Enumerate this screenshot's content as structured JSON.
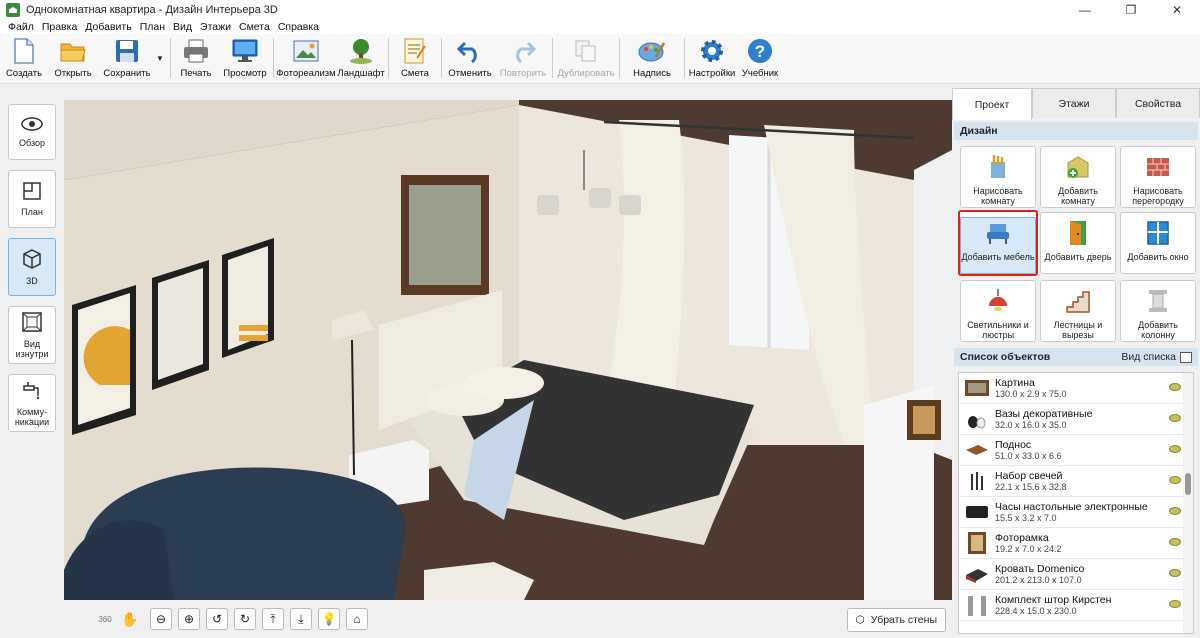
{
  "window": {
    "title": "Однокомнатная квартира - Дизайн Интерьера 3D"
  },
  "menu": [
    "Файл",
    "Правка",
    "Добавить",
    "План",
    "Вид",
    "Этажи",
    "Смета",
    "Справка"
  ],
  "toolbar": {
    "create": "Создать",
    "open": "Открыть",
    "save": "Сохранить",
    "print": "Печать",
    "preview": "Просмотр",
    "photorealism": "Фотореализм",
    "landscape": "Ландшафт",
    "estimate": "Смета",
    "undo": "Отменить",
    "redo": "Повторить",
    "duplicate": "Дублировать",
    "caption": "Надпись",
    "settings": "Настройки",
    "tutorial": "Учебник"
  },
  "left_panel": {
    "overview": "Обзор",
    "plan": "План",
    "view3d": "3D",
    "inside": "Вид изнутри",
    "utilities": "Комму-никации"
  },
  "right_panel": {
    "tabs": [
      "Проект",
      "Этажи",
      "Свойства"
    ],
    "active_tab": "Проект",
    "design_header": "Дизайн",
    "tools": [
      {
        "label": "Нарисовать комнату",
        "icon": "pencils-icon"
      },
      {
        "label": "Добавить комнату",
        "icon": "add-room-icon"
      },
      {
        "label": "Нарисовать перегородку",
        "icon": "brick-wall-icon"
      },
      {
        "label": "Добавить мебель",
        "icon": "armchair-icon"
      },
      {
        "label": "Добавить дверь",
        "icon": "door-icon"
      },
      {
        "label": "Добавить окно",
        "icon": "window-icon"
      },
      {
        "label": "Светильники и люстры",
        "icon": "ceiling-lamp-icon"
      },
      {
        "label": "Лестницы и вырезы",
        "icon": "stairs-icon"
      },
      {
        "label": "Добавить колонну",
        "icon": "column-icon"
      }
    ],
    "objects_header": "Список объектов",
    "list_view": "Вид списка",
    "objects": [
      {
        "name": "Картина",
        "dims": "130.0 x 2.9 x 75.0"
      },
      {
        "name": "Вазы декоративные",
        "dims": "32.0 x 16.0 x 35.0"
      },
      {
        "name": "Поднос",
        "dims": "51.0 x 33.0 x 6.6"
      },
      {
        "name": "Набор свечей",
        "dims": "22.1 x 15.6 x 32.8"
      },
      {
        "name": "Часы настольные электронные",
        "dims": "15.5 x 3.2 x 7.0"
      },
      {
        "name": "Фоторамка",
        "dims": "19.2 x 7.0 x 24.2"
      },
      {
        "name": "Кровать Domenico",
        "dims": "201.2 x 213.0 x 107.0"
      },
      {
        "name": "Комплект штор Кирстен",
        "dims": "228.4 x 15.0 x 230.0"
      }
    ]
  },
  "bottom": {
    "remove_walls": "Убрать стены",
    "rotate360": "360"
  }
}
